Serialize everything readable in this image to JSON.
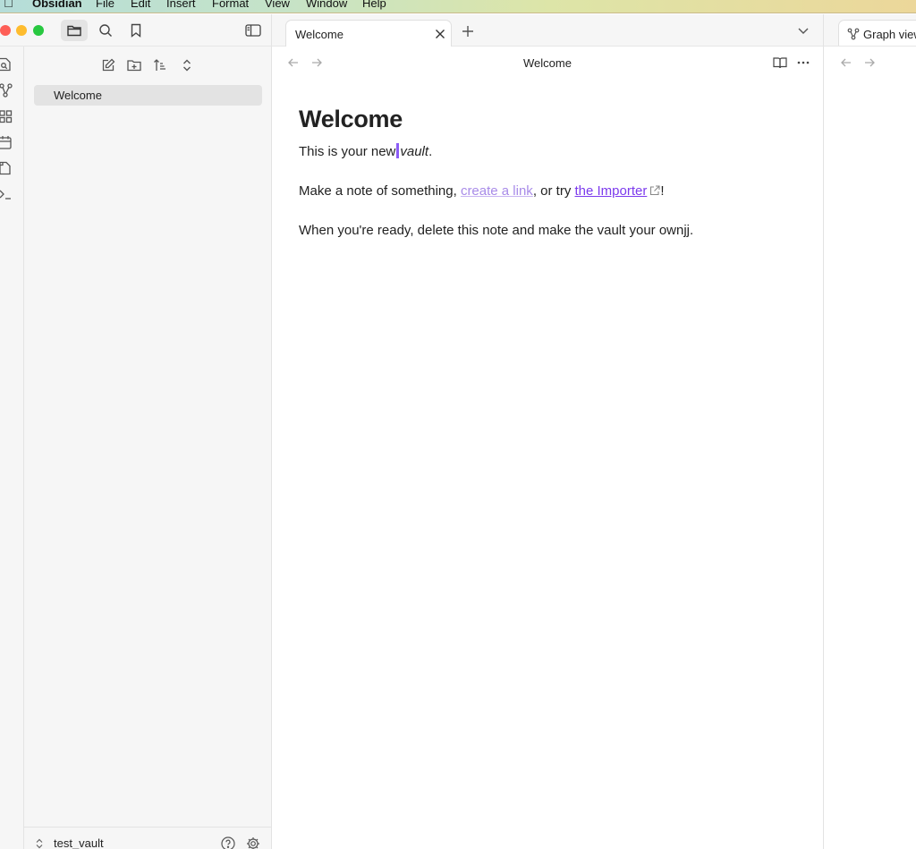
{
  "menubar": {
    "apple_icon": "apple-logo",
    "app_name": "Obsidian",
    "items": [
      "File",
      "Edit",
      "Insert",
      "Format",
      "View",
      "Window",
      "Help"
    ]
  },
  "window": {
    "traffic_lights": [
      "close",
      "minimize",
      "zoom"
    ]
  },
  "sidebar_header": {
    "buttons": [
      "files-icon",
      "search-icon",
      "bookmark-icon"
    ],
    "toggle": "sidebar-toggle-icon"
  },
  "ribbon": {
    "icons": [
      "quick-switcher-icon",
      "graph-icon",
      "canvas-icon",
      "daily-notes-icon",
      "templates-icon",
      "command-palette-icon"
    ]
  },
  "file_explorer": {
    "actions": [
      "new-note-icon",
      "new-folder-icon",
      "sort-icon",
      "collapse-icon"
    ],
    "files": [
      {
        "name": "Welcome"
      }
    ]
  },
  "vault": {
    "name": "test_vault",
    "icons": [
      "vault-switcher-icon",
      "help-icon",
      "settings-icon"
    ]
  },
  "tabs": [
    {
      "label": "Welcome"
    }
  ],
  "view_header": {
    "title": "Welcome"
  },
  "note": {
    "title": "Welcome",
    "p1_before": "This is your new",
    "p1_italic": "vault",
    "p1_after": ".",
    "p2_before": "Make a note of something, ",
    "p2_link_internal": "create a link",
    "p2_middle": ", or try ",
    "p2_link_external": "the Importer",
    "p2_after": "!",
    "p3": "When you're ready, delete this note and make the vault your ownjj."
  },
  "right_pane": {
    "tab_label": "Graph view"
  },
  "colors": {
    "accent": "#7c3aed",
    "internal_link": "#a88be8",
    "cursor": "#8b5cf6"
  }
}
